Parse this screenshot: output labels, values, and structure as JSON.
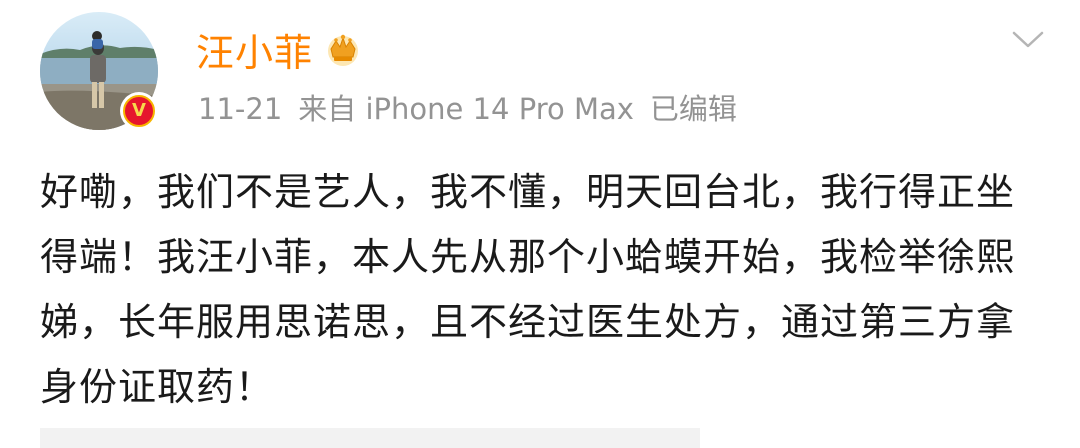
{
  "post": {
    "username": "汪小菲",
    "date": "11-21",
    "source": "来自 iPhone 14 Pro Max",
    "edited": "已编辑",
    "content": "好嘞，我们不是艺人，我不懂，明天回台北，我行得正坐得端！我汪小菲，本人先从那个小蛤蟆开始，我检举徐熙娣，长年服用思诺思，且不经过医生处方，通过第三方拿身份证取药！"
  },
  "badge": {
    "symbol": "V"
  },
  "icons": {
    "verified": "verified-v-badge",
    "crown": "crown-icon",
    "more": "chevron-down-icon"
  },
  "colors": {
    "username": "#ff8200",
    "meta": "#939393",
    "text": "#1a1a1a",
    "badge": "#e6162d"
  }
}
